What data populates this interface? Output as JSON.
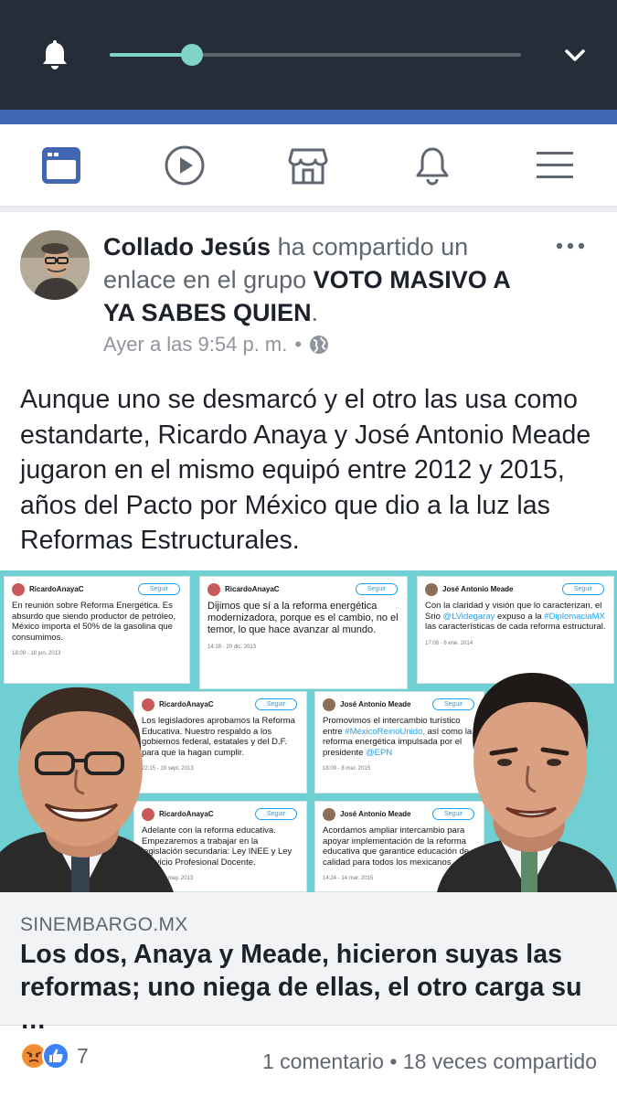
{
  "media": {
    "progress_fraction": 0.2,
    "accent_color": "#7fd3c9"
  },
  "nav": {
    "tabs": [
      {
        "icon": "news-feed-icon",
        "active": true
      },
      {
        "icon": "video-play-icon",
        "active": false
      },
      {
        "icon": "marketplace-icon",
        "active": false
      },
      {
        "icon": "notifications-bell-icon",
        "active": false
      },
      {
        "icon": "menu-icon",
        "active": false
      }
    ],
    "active_color": "#4267b2"
  },
  "post": {
    "author": "Collado Jesús",
    "action_text": " ha compartido un enlace en el grupo ",
    "group": "VOTO MASIVO A YA SABES QUIEN",
    "period": ".",
    "timestamp": "Ayer a las 9:54 p. m.",
    "separator": "•",
    "privacy_icon": "globe-icon",
    "body": "Aunque uno se desmarcó y el otro las usa como estandarte, Ricardo Anaya y José Antonio Meade jugaron en el mismo equipó entre 2012 y 2015, años del Pacto por México que dio a la luz las Reformas Estructurales.",
    "link": {
      "domain": "SINEMBARGO.MX",
      "title": "Los dos, Anaya y Meade, hicieron suyas las reformas; uno niega de ellas, el otro carga su …",
      "image": {
        "tweets": [
          {
            "author": "RicardoAnayaC",
            "follow": "Seguir",
            "text": "En reunión sobre Reforma Energética. Es absurdo que siendo productor de petróleo, México importa el 50% de la gasolina que consumimos.",
            "date": "18:09 - 18 jun. 2013"
          },
          {
            "author": "RicardoAnayaC",
            "follow": "Seguir",
            "text": "Dijimos que sí a la reforma energética modernizadora, porque es el cambio, no el temor, lo que hace avanzar al mundo.",
            "date": "14:18 - 20 dic. 2013"
          },
          {
            "author": "José Antonio Meade",
            "follow": "Seguir",
            "text": "Con la claridad y visión que lo caracterizan, el Srio @LVidegaray expuso a la #DiplomaciaMX las características de cada reforma estructural.",
            "date": "17:08 - 6 ene. 2014"
          },
          {
            "author": "RicardoAnayaC",
            "follow": "Seguir",
            "text": "Los legisladores aprobamos la Reforma Educativa. Nuestro respaldo a los gobiernos federal, estatales y del D.F. para que la hagan cumplir.",
            "date": "22:15 - 19 sept. 2013"
          },
          {
            "author": "José Antonio Meade",
            "follow": "Seguir",
            "text": "Promovimos el intercambio turístico entre #MéxicoReinoUnido, así como la reforma energética impulsada por el presidente @EPN",
            "date": "18:09 - 8 mar. 2015"
          },
          {
            "author": "RicardoAnayaC",
            "follow": "Seguir",
            "text": "Adelante con la reforma educativa. Empezaremos a trabajar en la legislación secundaria: Ley INEE y Ley Servicio Profesional Docente.",
            "date": "18:09 - 13 may. 2013"
          },
          {
            "author": "José Antonio Meade",
            "follow": "Seguir",
            "text": "Acordamos ampliar intercambio para apoyar implementación de la reforma educativa que garantice educación de calidad para todos los mexicanos",
            "date": "14:24 - 14 mar. 2015"
          }
        ]
      }
    },
    "reactions": {
      "icons": [
        "angry-reaction-icon",
        "like-reaction-icon"
      ],
      "count": "7"
    },
    "stats": "1 comentario • 18 veces compartido"
  }
}
